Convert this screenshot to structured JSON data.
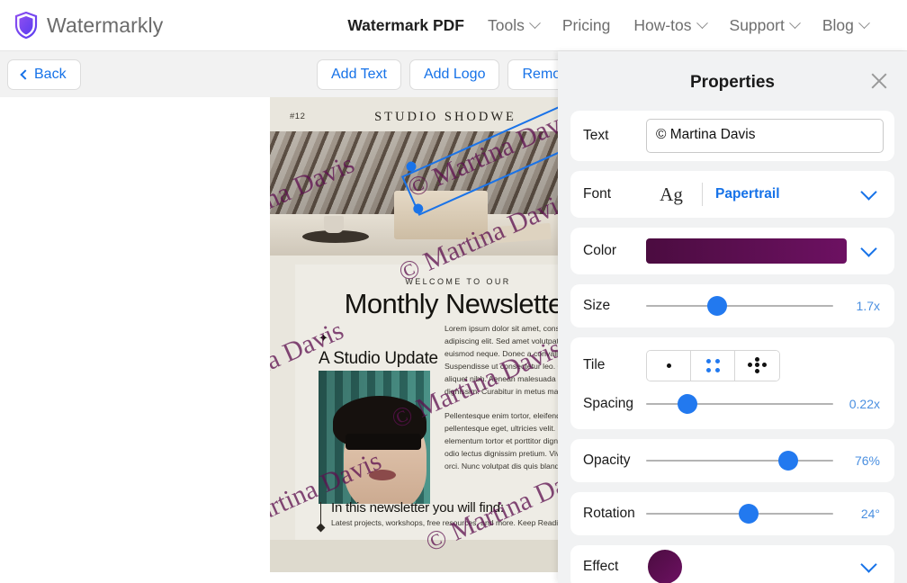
{
  "header": {
    "brand": "Watermarkly",
    "logo_icon": "shield-icon",
    "nav": [
      {
        "label": "Watermark PDF",
        "active": true,
        "caret": false
      },
      {
        "label": "Tools",
        "active": false,
        "caret": true
      },
      {
        "label": "Pricing",
        "active": false,
        "caret": false
      },
      {
        "label": "How-tos",
        "active": false,
        "caret": true
      },
      {
        "label": "Support",
        "active": false,
        "caret": true
      },
      {
        "label": "Blog",
        "active": false,
        "caret": true
      }
    ]
  },
  "toolbar": {
    "back": "Back",
    "add_text": "Add Text",
    "add_logo": "Add Logo",
    "remove": "Remove"
  },
  "document": {
    "page_number": "#12",
    "brand": "STUDIO SHODWE",
    "eyebrow": "WELCOME TO OUR",
    "headline": "Monthly Newsletter",
    "sparkle": "✦",
    "subhead": "A Studio Update",
    "paragraph_1": "Lorem ipsum dolor sit amet, consectetur adipiscing elit. Sed amet volutpat dui, sed euismod neque. Donec a convallis ex. Suspendisse ut consectetur leo. Quisque vel aliquet nibh. Aenean malesuada tincidunt dignissim. Curabitur in metus magna.",
    "paragraph_2": "Pellentesque enim tortor, eleifend quis pellentesque eget, ultricies velit. Sed elementum tortor et porttitor dignissim. Cras id odio lectus dignissim pretium. Vivamus laoreet orci. Nunc volutpat dis quis blandit ullamcorper.",
    "footer_title": "In this newsletter you will find:",
    "footer_sub": "Latest projects, workshops, free resources, and more. Keep Reading!",
    "watermark_text": "© Martina Davis"
  },
  "panel": {
    "title": "Properties",
    "close_icon": "close-icon",
    "text": {
      "label": "Text",
      "value": "© Martina Davis"
    },
    "font": {
      "label": "Font",
      "preview": "Ag",
      "value": "Papertrail",
      "chevron_icon": "chevron-down-icon"
    },
    "color": {
      "label": "Color",
      "value_hex": "#5e1150",
      "gradient_from": "#4b0c40",
      "gradient_to": "#6d1162",
      "chevron_icon": "chevron-down-icon"
    },
    "size": {
      "label": "Size",
      "value": "1.7x",
      "percent": 38
    },
    "tile": {
      "label": "Tile",
      "options": [
        "single-dot",
        "four-dots-grid",
        "five-dots-diamond"
      ],
      "selected_index": 1
    },
    "spacing": {
      "label": "Spacing",
      "value": "0.22x",
      "percent": 22
    },
    "opacity": {
      "label": "Opacity",
      "value": "76%",
      "percent": 76
    },
    "rotation": {
      "label": "Rotation",
      "value": "24°",
      "percent": 55
    },
    "effect": {
      "label": "Effect",
      "chevron_icon": "chevron-down-icon"
    }
  },
  "accent": {
    "blue": "#2279ef",
    "link_blue": "#1672e8",
    "purple": "#5e1150"
  }
}
